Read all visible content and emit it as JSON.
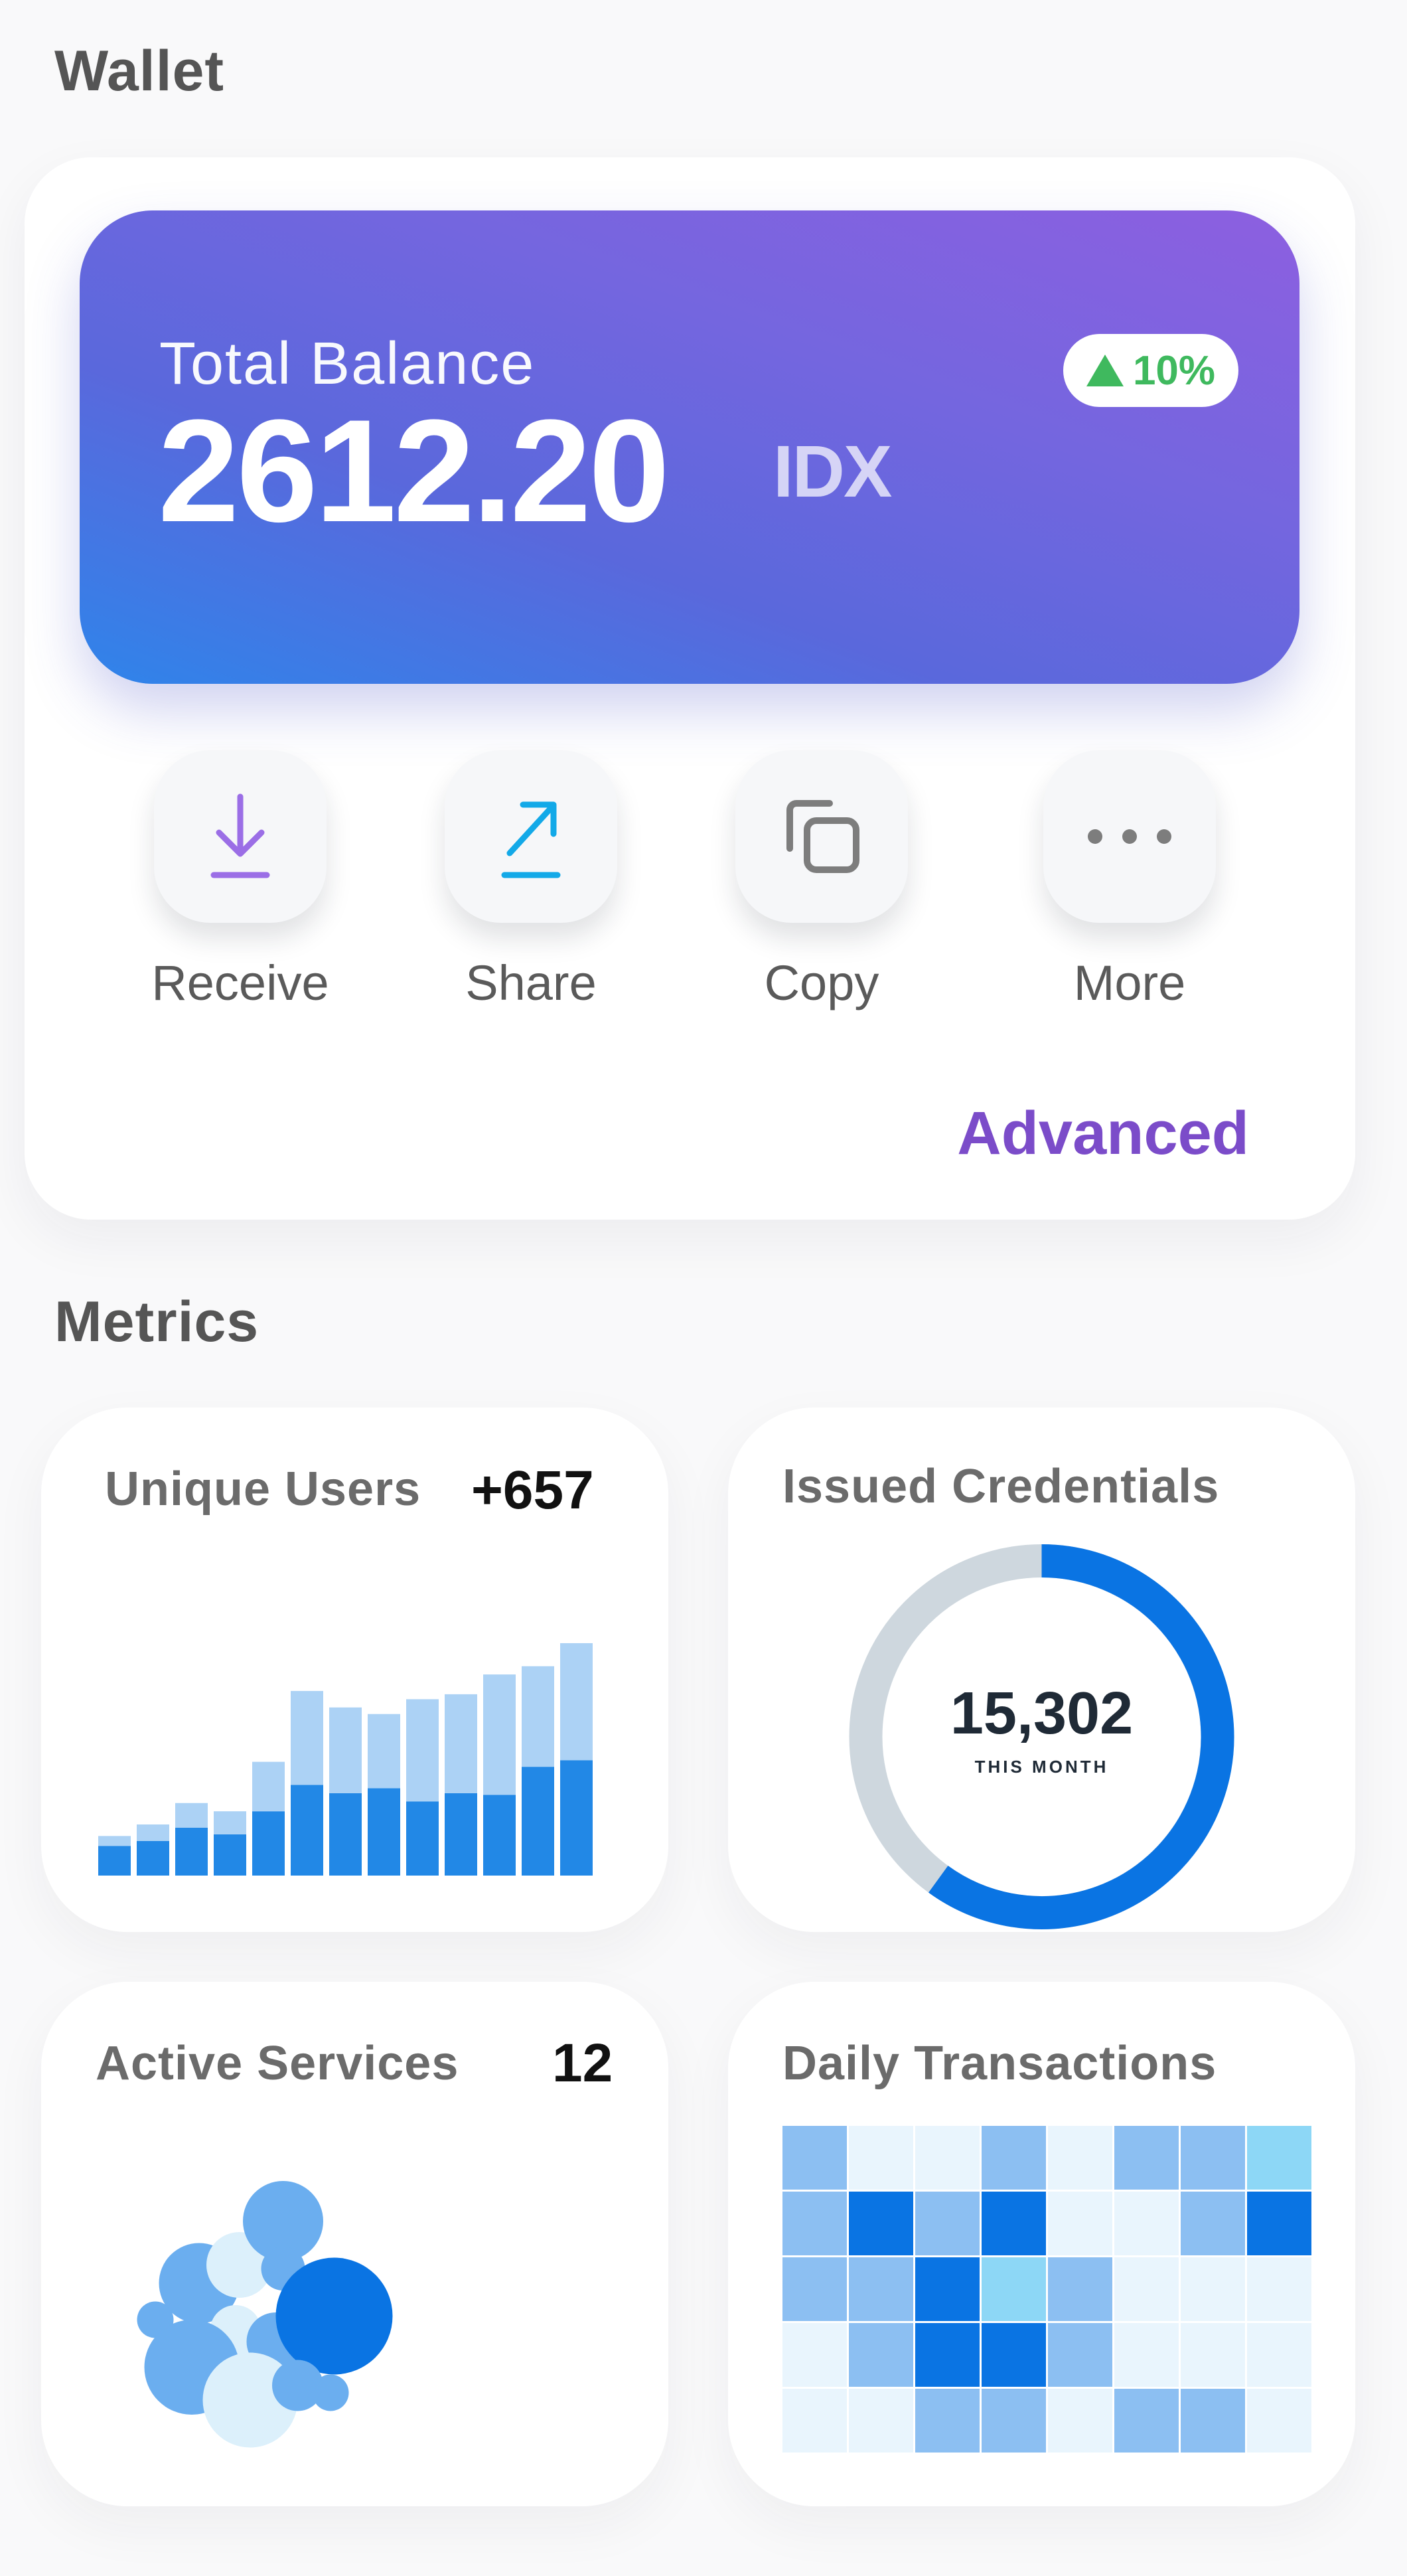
{
  "wallet": {
    "title": "Wallet",
    "balance_label": "Total Balance",
    "balance_value": "2612.20",
    "balance_unit": "IDX",
    "change_badge": "10%",
    "actions": [
      {
        "label": "Receive",
        "icon": "download-icon",
        "color": "#9b6ee6"
      },
      {
        "label": "Share",
        "icon": "share-arrow-icon",
        "color": "#13a9e8"
      },
      {
        "label": "Copy",
        "icon": "copy-icon",
        "color": "#7d7d7d"
      },
      {
        "label": "More",
        "icon": "more-dots-icon",
        "color": "#7d7d7d"
      }
    ],
    "advanced_link": "Advanced"
  },
  "metrics": {
    "title": "Metrics",
    "unique_users": {
      "title": "Unique Users",
      "value": "+657"
    },
    "issued_credentials": {
      "title": "Issued Credentials",
      "value": "15,302",
      "caption": "THIS MONTH",
      "progress": 0.6
    },
    "active_services": {
      "title": "Active Services",
      "value": "12"
    },
    "daily_transactions": {
      "title": "Daily Transactions"
    }
  },
  "colors": {
    "accent_purple": "#7b4cc9",
    "positive_green": "#3fb95e",
    "chart_blue_dark": "#2288e6",
    "chart_blue_light": "#acd2f5",
    "donut_blue": "#0a74e3",
    "donut_track": "#ced7de"
  },
  "chart_data": [
    {
      "type": "bar",
      "stacked": true,
      "series": [
        {
          "values": [
            1.8,
            2.1,
            2.9,
            2.5,
            3.9,
            5.5,
            5.0,
            5.3,
            4.5,
            5.0,
            4.9,
            6.6,
            7.0
          ]
        },
        {
          "values": [
            0.6,
            1.0,
            1.5,
            1.4,
            3.0,
            5.7,
            5.2,
            4.5,
            6.2,
            6.0,
            7.3,
            6.1,
            7.1
          ]
        }
      ],
      "xlabel": "",
      "ylabel": "",
      "grid": false,
      "ylim": [
        0,
        14.5
      ]
    },
    {
      "type": "pie",
      "variant": "donut",
      "values": [
        60,
        40
      ],
      "center_text": "15,302"
    },
    {
      "type": "scatter",
      "variant": "bubble",
      "points": [
        {
          "x": 2,
          "y": 4.2,
          "r": 0.5,
          "shade": 1
        },
        {
          "x": 3.2,
          "y": 5.2,
          "r": 1.1,
          "shade": 1
        },
        {
          "x": 4.3,
          "y": 5.7,
          "r": 0.9,
          "shade": 0
        },
        {
          "x": 5.5,
          "y": 6.9,
          "r": 1.1,
          "shade": 1
        },
        {
          "x": 5.5,
          "y": 5.6,
          "r": 0.6,
          "shade": 1
        },
        {
          "x": 4.2,
          "y": 3.9,
          "r": 0.7,
          "shade": 0
        },
        {
          "x": 5.3,
          "y": 3.6,
          "r": 0.8,
          "shade": 1
        },
        {
          "x": 6.9,
          "y": 4.3,
          "r": 1.6,
          "shade": 2
        },
        {
          "x": 3.0,
          "y": 2.9,
          "r": 1.3,
          "shade": 1
        },
        {
          "x": 4.6,
          "y": 2.0,
          "r": 1.3,
          "shade": 0
        },
        {
          "x": 5.9,
          "y": 2.4,
          "r": 0.7,
          "shade": 1
        },
        {
          "x": 6.8,
          "y": 2.2,
          "r": 0.5,
          "shade": 1
        }
      ],
      "shade_colors": [
        "#dcf0fb",
        "#6baeef",
        "#0a74e3"
      ]
    },
    {
      "type": "heatmap",
      "rows": 5,
      "cols": 8,
      "values": [
        [
          2,
          1,
          1,
          2,
          1,
          2,
          2,
          3
        ],
        [
          2,
          4,
          2,
          4,
          1,
          1,
          2,
          4
        ],
        [
          2,
          2,
          4,
          3,
          2,
          1,
          1,
          1
        ],
        [
          1,
          2,
          4,
          4,
          2,
          1,
          1,
          1
        ],
        [
          1,
          1,
          2,
          2,
          1,
          2,
          2,
          1
        ]
      ],
      "palette": [
        "#ffffff",
        "#e9f5fd",
        "#8cbff2",
        "#8dd7f6",
        "#0a74e3"
      ]
    }
  ]
}
